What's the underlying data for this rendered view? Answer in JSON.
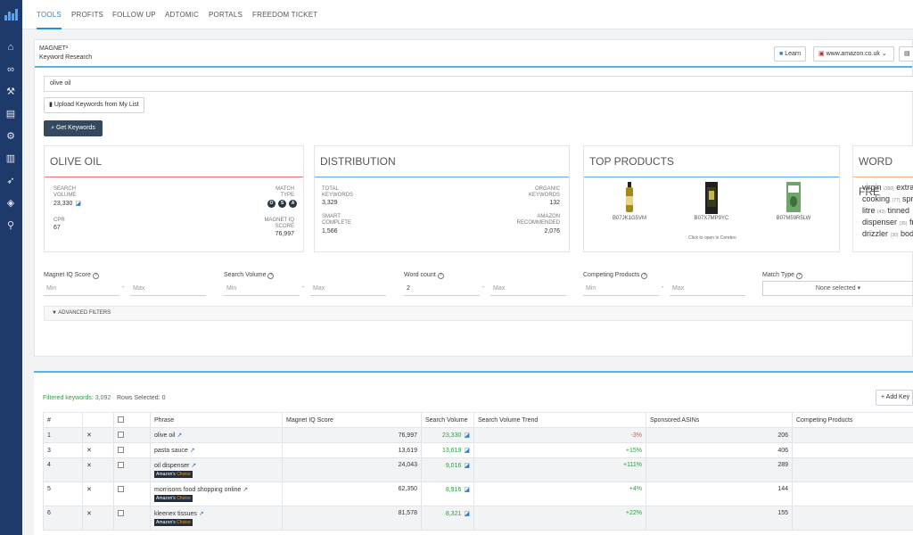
{
  "nav": {
    "tabs": [
      "TOOLS",
      "PROFITS",
      "FOLLOW UP",
      "ADTOMIC",
      "PORTALS",
      "FREEDOM TICKET"
    ],
    "active": "TOOLS"
  },
  "sidebar": {
    "icons": [
      "home-icon",
      "binoculars-icon",
      "tools-icon",
      "document-icon",
      "gears-icon",
      "chart-icon",
      "rocket-icon",
      "graduation-icon",
      "pin-icon"
    ]
  },
  "header": {
    "brand": "MAGNET²",
    "subtitle": "Keyword Research",
    "learn_label": "Learn",
    "marketplace": "www.amazon.co.uk"
  },
  "search": {
    "value": "olive oil",
    "upload_label": "Upload Keywords from My List",
    "get_label": "Get Keywords"
  },
  "card_olive": {
    "title": "OLIVE OIL",
    "search_volume_label": "SEARCH VOLUME",
    "search_volume": "23,330",
    "match_type_label": "MATCH TYPE",
    "match_badges": [
      "O",
      "S",
      "A"
    ],
    "cpr_label": "CPR",
    "cpr": "67",
    "iq_label": "MAGNET IQ SCORE",
    "iq": "76,997"
  },
  "card_dist": {
    "title": "DISTRIBUTION",
    "total_label": "TOTAL KEYWORDS",
    "total": "3,329",
    "organic_label": "ORGANIC KEYWORDS",
    "organic": "132",
    "smart_label": "SMART COMPLETE",
    "smart": "1,566",
    "amazon_label": "AMAZON RECOMMENDED",
    "amazon": "2,076"
  },
  "card_top": {
    "title": "TOP PRODUCTS",
    "products": [
      "B07JK1G5VM",
      "B07X7MP9YC",
      "B07M59R5LW"
    ],
    "hint": "Click to open in Cerebro"
  },
  "card_wf": {
    "title": "WORD FRE",
    "rows": [
      [
        {
          "w": "virgin",
          "c": "(260)"
        },
        {
          "w": "extra",
          "c": ""
        }
      ],
      [
        {
          "w": "cooking",
          "c": "(77)"
        },
        {
          "w": "spr",
          "c": ""
        }
      ],
      [
        {
          "w": "litre",
          "c": "(42)"
        },
        {
          "w": "tinned",
          "c": ""
        }
      ],
      [
        {
          "w": "dispenser",
          "c": "(35)"
        },
        {
          "w": "fr",
          "c": ""
        }
      ],
      [
        {
          "w": "drizzler",
          "c": "(30)"
        },
        {
          "w": "bod",
          "c": ""
        }
      ]
    ]
  },
  "filters": {
    "iq_label": "Magnet IQ Score",
    "sv_label": "Search Volume",
    "wc_label": "Word count",
    "cp_label": "Competing Products",
    "mt_label": "Match Type",
    "min": "Min",
    "max": "Max",
    "wc_value": "2",
    "mt_value": "None selected",
    "advanced": "ADVANCED FILTERS"
  },
  "results": {
    "filtered_label": "Filtered keywords:",
    "filtered": "3,092",
    "selected_label": "Rows Selected:",
    "selected": "0",
    "add_label": "Add Key",
    "columns": [
      "#",
      "",
      "",
      "Phrase",
      "Magnet IQ Score",
      "Search Volume",
      "Search Volume Trend",
      "Sponsored ASINs",
      "Competing Products"
    ],
    "rows": [
      {
        "n": "1",
        "phrase": "olive oil",
        "iq": "76,997",
        "sv": "23,330",
        "trend": "-3%",
        "trend_dir": "down",
        "asins": "206",
        "badge": false
      },
      {
        "n": "3",
        "phrase": "pasta sauce",
        "iq": "13,619",
        "sv": "13,619",
        "trend": "+15%",
        "trend_dir": "up",
        "asins": "406",
        "badge": false
      },
      {
        "n": "4",
        "phrase": "oil dispenser",
        "iq": "24,043",
        "sv": "9,016",
        "trend": "+111%",
        "trend_dir": "up",
        "asins": "289",
        "badge": true
      },
      {
        "n": "5",
        "phrase": "morrisons food shopping online",
        "iq": "62,350",
        "sv": "8,916",
        "trend": "+4%",
        "trend_dir": "up",
        "asins": "144",
        "badge": true
      },
      {
        "n": "6",
        "phrase": "kleenex tissues",
        "iq": "81,578",
        "sv": "8,321",
        "trend": "+22%",
        "trend_dir": "up",
        "asins": "155",
        "badge": true
      }
    ],
    "badge_text_a": "Amazon's",
    "badge_text_b": "Choice"
  }
}
